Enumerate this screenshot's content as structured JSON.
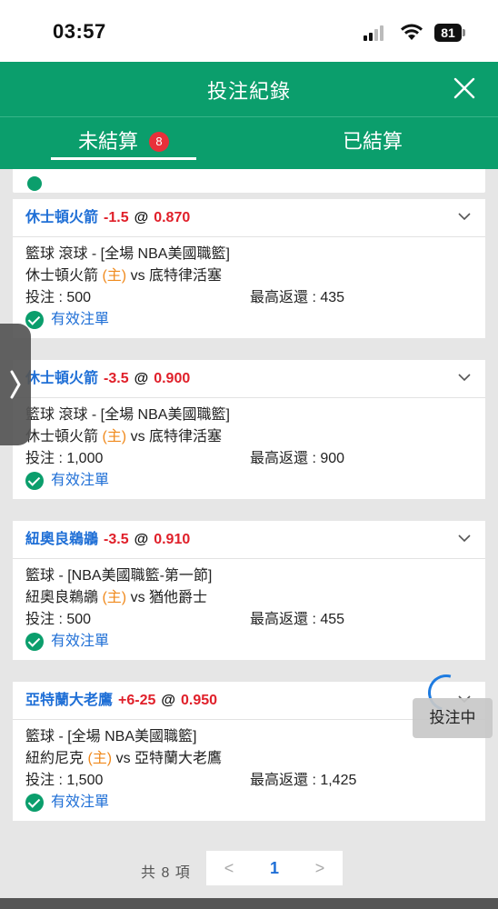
{
  "status_bar": {
    "time": "03:57",
    "battery": "81",
    "icons": [
      "signal-icon",
      "wifi-icon",
      "battery-icon"
    ]
  },
  "header": {
    "title": "投注紀錄",
    "close_icon": "close-icon"
  },
  "tabs": {
    "unsettled_label": "未結算",
    "unsettled_count": "8",
    "settled_label": "已結算"
  },
  "bets": [
    {
      "team": "休士頓火箭",
      "handicap": "-1.5",
      "at": "@",
      "odds": "0.870",
      "league": "籃球 滾球 - [全場 NBA美國職籃]",
      "home_team": "休士頓火箭",
      "home_marker": "(主)",
      "vs": "vs",
      "away_team": "底特律活塞",
      "stake": "投注 : 500",
      "max_return": "最高返還 : 435",
      "status": "有效注單"
    },
    {
      "team": "休士頓火箭",
      "handicap": "-3.5",
      "at": "@",
      "odds": "0.900",
      "league": "籃球 滾球 - [全場 NBA美國職籃]",
      "home_team": "休士頓火箭",
      "home_marker": "(主)",
      "vs": "vs",
      "away_team": "底特律活塞",
      "stake": "投注 : 1,000",
      "max_return": "最高返還 : 900",
      "status": "有效注單"
    },
    {
      "team": "紐奧良鵜鶘",
      "handicap": "-3.5",
      "at": "@",
      "odds": "0.910",
      "league": "籃球 - [NBA美國職籃-第一節]",
      "home_team": "紐奧良鵜鶘",
      "home_marker": "(主)",
      "vs": "vs",
      "away_team": "猶他爵士",
      "stake": "投注 : 500",
      "max_return": "最高返還 : 455",
      "status": "有效注單"
    },
    {
      "team": "亞特蘭大老鷹",
      "handicap": "+6-25",
      "at": "@",
      "odds": "0.950",
      "league": "籃球 - [全場 NBA美國職籃]",
      "home_team": "紐約尼克",
      "home_marker": "(主)",
      "vs": "vs",
      "away_team": "亞特蘭大老鷹",
      "stake": "投注 : 1,500",
      "max_return": "最高返還 : 1,425",
      "status": "有效注單"
    }
  ],
  "floating": {
    "betting_label": "投注中"
  },
  "pager": {
    "total": "共 8 項",
    "prev": "<",
    "current": "1",
    "next": ">"
  },
  "colors": {
    "brand_green": "#0b9e6c",
    "link_blue": "#1f6fd6",
    "odds_red": "#e0202a",
    "home_orange": "#f08a1d",
    "badge_red": "#e8303a"
  }
}
